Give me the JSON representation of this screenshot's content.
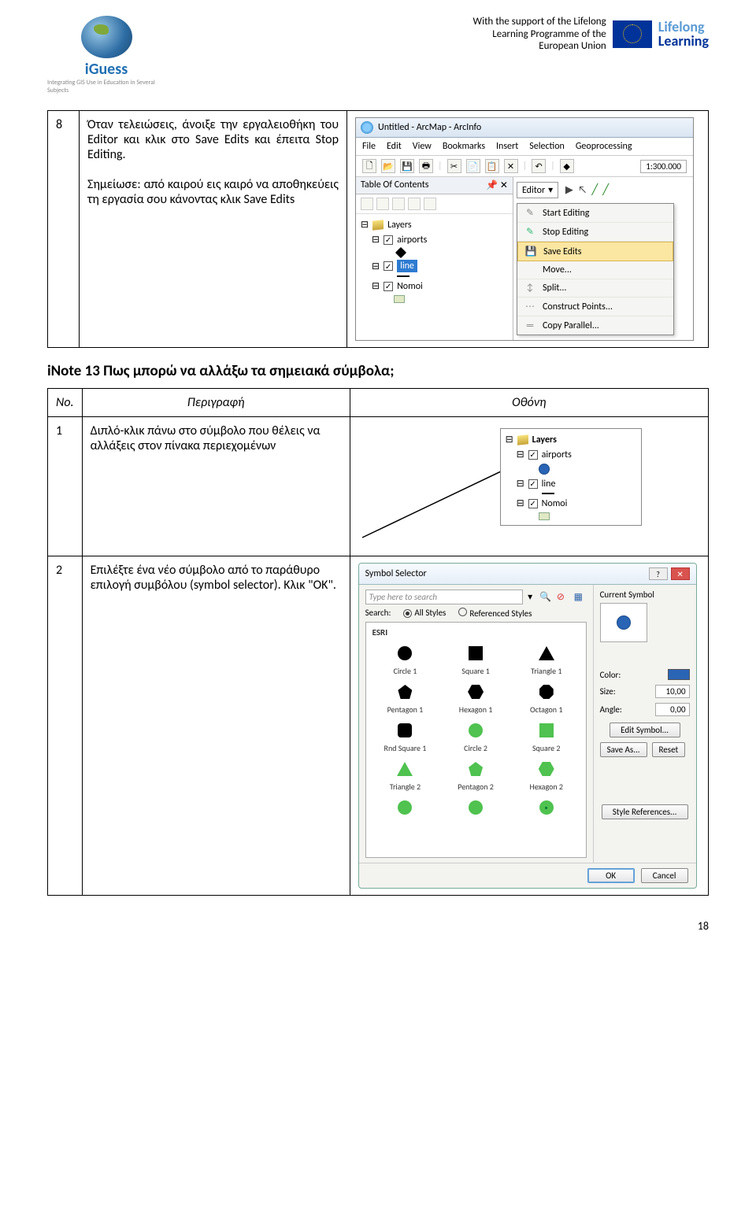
{
  "header": {
    "logo_text": "iGuess",
    "logo_sub": "Integrating GIS Use in Education in Several Subjects",
    "support_line1": "With the support of the Lifelong",
    "support_line2": "Learning Programme of the",
    "support_line3": "European Union",
    "lifelong1": "Lifelong",
    "lifelong2": "Learning"
  },
  "step8": {
    "num": "8",
    "para1": "Όταν τελειώσεις, άνοιξε την εργαλειοθήκη του Editor και κλικ στο Save Edits  και έπειτα Stop Editing.",
    "para2": "Σημείωσε: από καιρού εις καιρό να αποθηκεύεις τη εργασία σου κάνοντας κλικ Save Edits"
  },
  "arcmap": {
    "title": "Untitled - ArcMap - ArcInfo",
    "menus": [
      "File",
      "Edit",
      "View",
      "Bookmarks",
      "Insert",
      "Selection",
      "Geoprocessing"
    ],
    "scale": "1:300.000",
    "toc_title": "Table Of Contents",
    "toc_pin": "📌 ✕",
    "layers": "Layers",
    "airports": "airports",
    "line": "line",
    "nomoi": "Nomoi",
    "editor_label": "Editor",
    "ctx": {
      "start": "Start Editing",
      "stop": "Stop Editing",
      "save": "Save Edits",
      "move": "Move...",
      "split": "Split...",
      "construct": "Construct Points...",
      "copy": "Copy Parallel..."
    }
  },
  "inote13": {
    "title": "iNote 13    Πως μπορώ να αλλάξω τα σημειακά σύμβολα;",
    "hdr_no": "No.",
    "hdr_desc": "Περιγραφή",
    "hdr_screen": "Οθόνη"
  },
  "row1": {
    "num": "1",
    "desc": "Διπλό-κλικ πάνω στο σύμβολο  που θέλεις να αλλάξεις στον πίνακα περιεχομένων"
  },
  "row2": {
    "num": "2",
    "desc": "Επιλέξτε ένα νέο σύμβολο από το παράθυρο επιλογή συμβόλου  (symbol selector).  Κλικ \"ΟΚ\"."
  },
  "symsel": {
    "title": "Symbol Selector",
    "search_ph": "Type here to search",
    "search_label": "Search:",
    "all_styles": "All Styles",
    "ref_styles": "Referenced Styles",
    "esri": "ESRI",
    "current": "Current Symbol",
    "color": "Color:",
    "size": "Size:",
    "size_val": "10,00",
    "angle": "Angle:",
    "angle_val": "0,00",
    "edit": "Edit Symbol...",
    "saveas": "Save As...",
    "reset": "Reset",
    "styleref": "Style References...",
    "ok": "OK",
    "cancel": "Cancel",
    "symbols": [
      {
        "cls": "shape-circle-bk",
        "label": "Circle 1"
      },
      {
        "cls": "shape-square-bk",
        "label": "Square 1"
      },
      {
        "cls": "shape-tri-bk",
        "label": "Triangle 1"
      },
      {
        "cls": "shape-pent-bk",
        "label": "Pentagon 1"
      },
      {
        "cls": "shape-hex-bk",
        "label": "Hexagon 1"
      },
      {
        "cls": "shape-oct-bk",
        "label": "Octagon 1"
      },
      {
        "cls": "shape-rsq-bk",
        "label": "Rnd Square 1"
      },
      {
        "cls": "shape-circle-gn",
        "label": "Circle 2"
      },
      {
        "cls": "shape-square-gn",
        "label": "Square 2"
      },
      {
        "cls": "shape-tri-gn",
        "label": "Triangle 2"
      },
      {
        "cls": "shape-pent-gn",
        "label": "Pentagon 2"
      },
      {
        "cls": "shape-hex-gn",
        "label": "Hexagon 2"
      },
      {
        "cls": "shape-circle-gn",
        "label": ""
      },
      {
        "cls": "shape-circle-gn",
        "label": ""
      },
      {
        "cls": "shape-circle-gn-dot",
        "label": ""
      }
    ]
  },
  "page_num": "18"
}
